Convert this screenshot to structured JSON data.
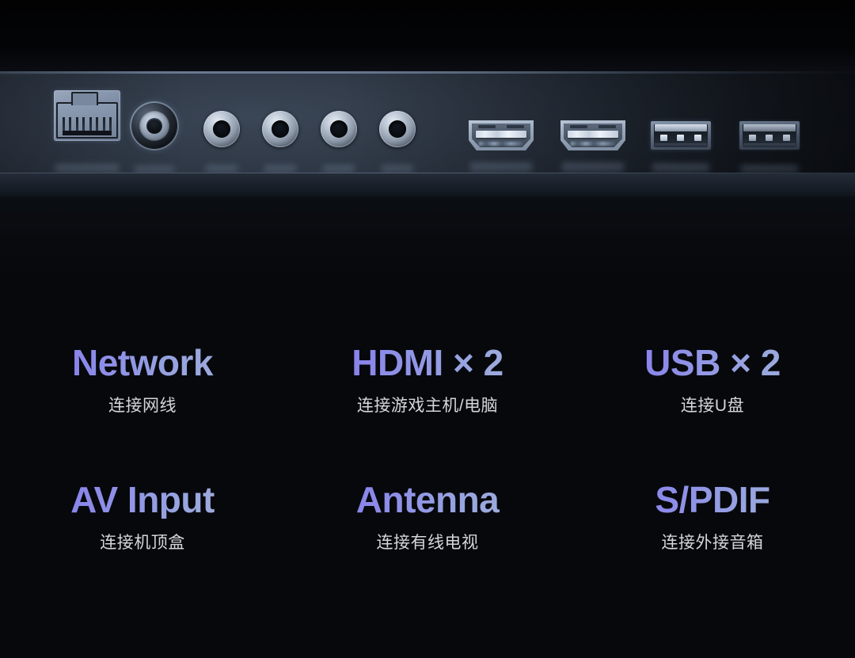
{
  "hardware_photo": {
    "alt": "TV rear input/output port panel",
    "ports": [
      {
        "id": "rj45",
        "icon": "ethernet-rj45-port-icon",
        "type": "Ethernet RJ45"
      },
      {
        "id": "coax",
        "icon": "coaxial-antenna-port-icon",
        "type": "Coaxial antenna (RF)"
      },
      {
        "id": "jack1",
        "icon": "av-jack-port-icon",
        "type": "AV / audio jack"
      },
      {
        "id": "jack2",
        "icon": "av-jack-port-icon",
        "type": "AV / audio jack"
      },
      {
        "id": "jack3",
        "icon": "av-jack-port-icon",
        "type": "AV / audio jack"
      },
      {
        "id": "jack4",
        "icon": "av-jack-port-icon",
        "type": "AV / audio jack"
      },
      {
        "id": "hdmi1",
        "icon": "hdmi-port-icon",
        "type": "HDMI"
      },
      {
        "id": "hdmi2",
        "icon": "hdmi-port-icon",
        "type": "HDMI"
      },
      {
        "id": "usb1",
        "icon": "usb-a-port-icon",
        "type": "USB Type-A"
      },
      {
        "id": "usb2",
        "icon": "usb-a-port-icon",
        "type": "USB Type-A"
      }
    ]
  },
  "colors": {
    "background": "#07080c",
    "title_gradient_start": "#7b6fe8",
    "title_gradient_end": "#a6b6d6",
    "subtitle": "#d3d6dc",
    "panel_metal": "#2c3542"
  },
  "features": [
    {
      "title": "Network",
      "subtitle": "连接网线"
    },
    {
      "title": "HDMI × 2",
      "subtitle": "连接游戏主机/电脑"
    },
    {
      "title": "USB × 2",
      "subtitle": "连接U盘"
    },
    {
      "title": "AV Input",
      "subtitle": "连接机顶盒"
    },
    {
      "title": "Antenna",
      "subtitle": "连接有线电视"
    },
    {
      "title": "S/PDIF",
      "subtitle": "连接外接音箱"
    }
  ]
}
